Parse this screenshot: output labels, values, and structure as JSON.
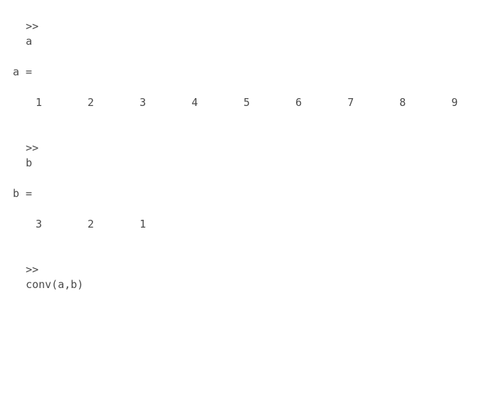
{
  "session": {
    "prompt": ">>",
    "entries": [
      {
        "input": "a",
        "output_label": "a =",
        "vector": [
          "1",
          "2",
          "3",
          "4",
          "5",
          "6",
          "7",
          "8",
          "9"
        ]
      },
      {
        "input": "b",
        "output_label": "b =",
        "vector": [
          "3",
          "2",
          "1"
        ]
      },
      {
        "input": "conv(a,b)",
        "output_label": null,
        "vector": null
      }
    ]
  }
}
